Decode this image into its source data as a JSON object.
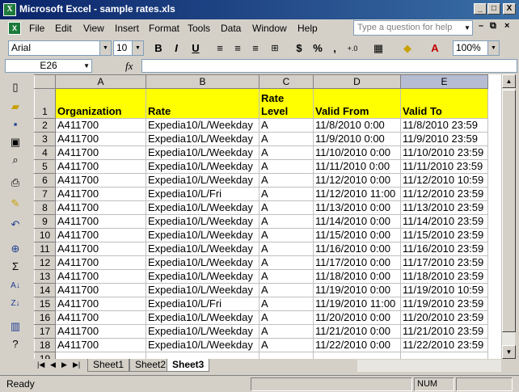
{
  "window": {
    "title": "Microsoft Excel - sample rates.xls",
    "app_icon": "X",
    "minimize": "_",
    "maximize": "□",
    "close": "X"
  },
  "menu": {
    "doc_icon": "X",
    "items": [
      "File",
      "Edit",
      "View",
      "Insert",
      "Format",
      "Tools",
      "Data",
      "Window",
      "Help"
    ],
    "question_placeholder": "Type a question for help",
    "doc_minimize": "–",
    "doc_restore": "⧉",
    "doc_close": "×"
  },
  "toolbar": {
    "font": "Arial",
    "size": "10",
    "bold": "B",
    "italic": "I",
    "underline": "U",
    "currency": "$",
    "percent": "%",
    "comma": ",",
    "increase_decimal": "+.0",
    "zoom": "100%"
  },
  "formula_bar": {
    "name_box": "E26",
    "fx": "fx",
    "formula": ""
  },
  "sheet": {
    "columns": [
      "A",
      "B",
      "C",
      "D",
      "E"
    ],
    "selected_column": "E",
    "header_row": {
      "number": "1",
      "cells": [
        "Organization",
        "Rate",
        "Rate Level",
        "Valid From",
        "Valid To"
      ]
    },
    "rows": [
      {
        "n": "2",
        "c": [
          "A411700",
          "Expedia10/L/Weekday",
          "A",
          "11/8/2010 0:00",
          "11/8/2010 23:59"
        ]
      },
      {
        "n": "3",
        "c": [
          "A411700",
          "Expedia10/L/Weekday",
          "A",
          "11/9/2010 0:00",
          "11/9/2010 23:59"
        ]
      },
      {
        "n": "4",
        "c": [
          "A411700",
          "Expedia10/L/Weekday",
          "A",
          "11/10/2010 0:00",
          "11/10/2010 23:59"
        ]
      },
      {
        "n": "5",
        "c": [
          "A411700",
          "Expedia10/L/Weekday",
          "A",
          "11/11/2010 0:00",
          "11/11/2010 23:59"
        ]
      },
      {
        "n": "6",
        "c": [
          "A411700",
          "Expedia10/L/Weekday",
          "A",
          "11/12/2010 0:00",
          "11/12/2010 10:59"
        ]
      },
      {
        "n": "7",
        "c": [
          "A411700",
          "Expedia10/L/Fri",
          "A",
          "11/12/2010 11:00",
          "11/12/2010 23:59"
        ]
      },
      {
        "n": "8",
        "c": [
          "A411700",
          "Expedia10/L/Weekday",
          "A",
          "11/13/2010 0:00",
          "11/13/2010 23:59"
        ]
      },
      {
        "n": "9",
        "c": [
          "A411700",
          "Expedia10/L/Weekday",
          "A",
          "11/14/2010 0:00",
          "11/14/2010 23:59"
        ]
      },
      {
        "n": "10",
        "c": [
          "A411700",
          "Expedia10/L/Weekday",
          "A",
          "11/15/2010 0:00",
          "11/15/2010 23:59"
        ]
      },
      {
        "n": "11",
        "c": [
          "A411700",
          "Expedia10/L/Weekday",
          "A",
          "11/16/2010 0:00",
          "11/16/2010 23:59"
        ]
      },
      {
        "n": "12",
        "c": [
          "A411700",
          "Expedia10/L/Weekday",
          "A",
          "11/17/2010 0:00",
          "11/17/2010 23:59"
        ]
      },
      {
        "n": "13",
        "c": [
          "A411700",
          "Expedia10/L/Weekday",
          "A",
          "11/18/2010 0:00",
          "11/18/2010 23:59"
        ]
      },
      {
        "n": "14",
        "c": [
          "A411700",
          "Expedia10/L/Weekday",
          "A",
          "11/19/2010 0:00",
          "11/19/2010 10:59"
        ]
      },
      {
        "n": "15",
        "c": [
          "A411700",
          "Expedia10/L/Fri",
          "A",
          "11/19/2010 11:00",
          "11/19/2010 23:59"
        ]
      },
      {
        "n": "16",
        "c": [
          "A411700",
          "Expedia10/L/Weekday",
          "A",
          "11/20/2010 0:00",
          "11/20/2010 23:59"
        ]
      },
      {
        "n": "17",
        "c": [
          "A411700",
          "Expedia10/L/Weekday",
          "A",
          "11/21/2010 0:00",
          "11/21/2010 23:59"
        ]
      },
      {
        "n": "18",
        "c": [
          "A411700",
          "Expedia10/L/Weekday",
          "A",
          "11/22/2010 0:00",
          "11/22/2010 23:59"
        ]
      },
      {
        "n": "19",
        "c": [
          "",
          "",
          "",
          "",
          ""
        ]
      }
    ],
    "tabs": [
      "Sheet1",
      "Sheet2",
      "Sheet3"
    ],
    "active_tab": "Sheet3",
    "header_fill": "#ffff00"
  },
  "status": {
    "text": "Ready",
    "num": "NUM"
  }
}
